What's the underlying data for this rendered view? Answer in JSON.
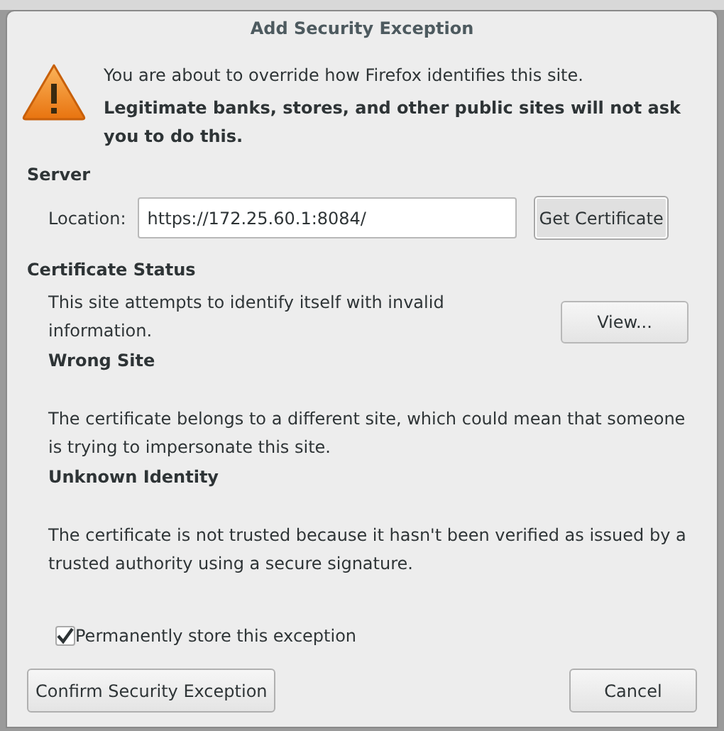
{
  "dialog": {
    "title": "Add Security Exception"
  },
  "warning": {
    "message": "You are about to override how Firefox identifies this site.",
    "emphasis": "Legitimate banks, stores, and other public sites will not ask you to do this."
  },
  "server": {
    "heading": "Server",
    "location_label": "Location:",
    "location_value": "https://172.25.60.1:8084/",
    "get_certificate_button": "Get Certificate"
  },
  "certificate_status": {
    "heading": "Certificate Status",
    "view_button": "View...",
    "items": [
      {
        "kind": "text",
        "text": "This site attempts to identify itself with invalid information."
      },
      {
        "kind": "heading",
        "text": "Wrong Site"
      },
      {
        "kind": "text",
        "text": "The certificate belongs to a different site, which could mean that someone is trying to impersonate this site."
      },
      {
        "kind": "heading",
        "text": "Unknown Identity"
      },
      {
        "kind": "text",
        "text": "The certificate is not trusted because it hasn't been verified as issued by a trusted authority using a secure signature."
      }
    ]
  },
  "permanent": {
    "label": "Permanently store this exception",
    "checked": true
  },
  "buttons": [
    {
      "label": "Confirm Security Exception"
    },
    {
      "label": "Cancel"
    }
  ]
}
